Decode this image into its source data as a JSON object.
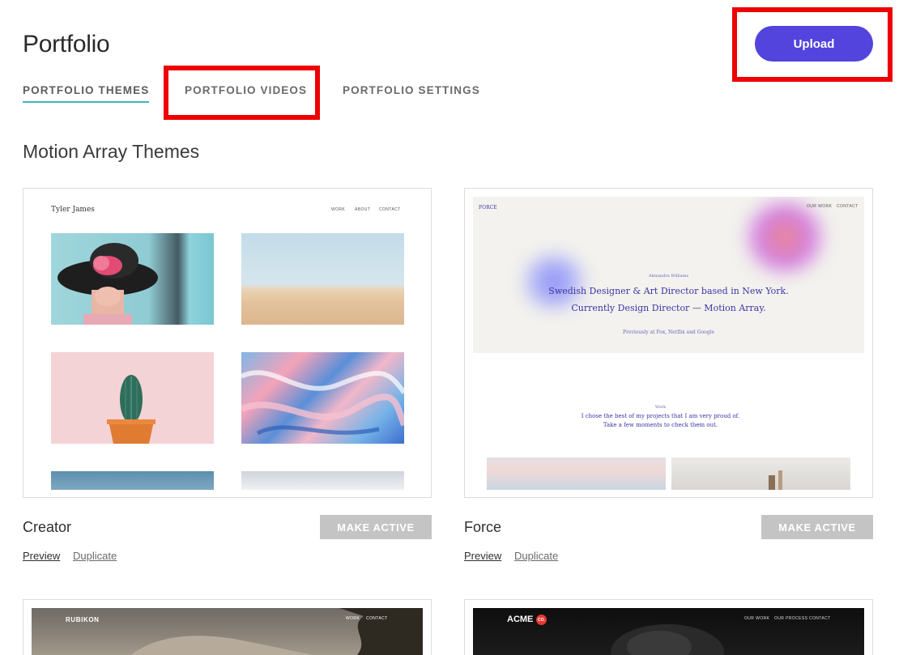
{
  "header": {
    "title": "Portfolio",
    "upload_label": "Upload"
  },
  "tabs": [
    {
      "label": "PORTFOLIO THEMES",
      "active": true
    },
    {
      "label": "PORTFOLIO VIDEOS",
      "active": false
    },
    {
      "label": "PORTFOLIO SETTINGS",
      "active": false
    }
  ],
  "section": {
    "title": "Motion Array Themes"
  },
  "themes": [
    {
      "name": "Creator",
      "action_label": "MAKE ACTIVE",
      "preview_label": "Preview",
      "duplicate_label": "Duplicate",
      "thumb": {
        "brand": "Tyler James",
        "nav": [
          "WORK",
          "ABOUT",
          "CONTACT"
        ]
      }
    },
    {
      "name": "Force",
      "action_label": "MAKE ACTIVE",
      "preview_label": "Preview",
      "duplicate_label": "Duplicate",
      "thumb": {
        "brand": "FORCE",
        "nav": [
          "OUR WORK",
          "CONTACT"
        ],
        "kicker": "Alexandra Williams",
        "headline_1": "Swedish Designer & Art Director based in New York.",
        "headline_2": "Currently Design Director — Motion Array.",
        "previously": "Previously at Fox, Netflix and Google",
        "work_label": "Work",
        "work_text_1": "I chose the best of my projects that I am very proud of.",
        "work_text_2": "Take a few moments to check them out."
      }
    },
    {
      "thumb": {
        "brand": "RUBIKON",
        "nav": [
          "WORK",
          "CONTACT"
        ]
      }
    },
    {
      "thumb": {
        "brand": "ACME",
        "brand_badge": "CO.",
        "nav": [
          "OUR WORK",
          "OUR PROCESS",
          "CONTACT"
        ]
      }
    }
  ],
  "colors": {
    "accent": "#5244dd",
    "tab_underline": "#3fb5c4",
    "highlight": "#ee0000",
    "button_disabled": "#c4c4c4"
  }
}
